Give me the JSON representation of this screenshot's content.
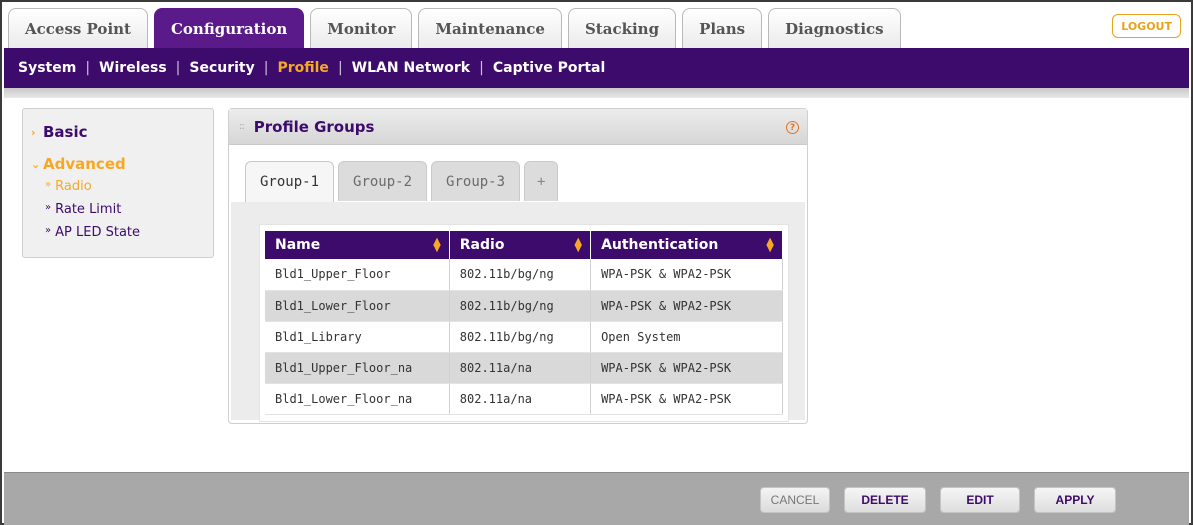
{
  "top_tabs": [
    {
      "label": "Access Point",
      "active": false
    },
    {
      "label": "Configuration",
      "active": true
    },
    {
      "label": "Monitor",
      "active": false
    },
    {
      "label": "Maintenance",
      "active": false
    },
    {
      "label": "Stacking",
      "active": false
    },
    {
      "label": "Plans",
      "active": false
    },
    {
      "label": "Diagnostics",
      "active": false
    }
  ],
  "logout_label": "LOGOUT",
  "subnav": [
    {
      "label": "System",
      "active": false
    },
    {
      "label": "Wireless",
      "active": false
    },
    {
      "label": "Security",
      "active": false
    },
    {
      "label": "Profile",
      "active": true
    },
    {
      "label": "WLAN Network",
      "active": false
    },
    {
      "label": "Captive Portal",
      "active": false
    }
  ],
  "left_menu": {
    "basic": "Basic",
    "advanced": "Advanced",
    "sub_items": [
      {
        "label": "Radio",
        "active": true
      },
      {
        "label": "Rate Limit",
        "active": false
      },
      {
        "label": "AP LED State",
        "active": false
      }
    ]
  },
  "panel": {
    "title": "Profile Groups",
    "help_icon_glyph": "?",
    "group_tabs": [
      "Group-1",
      "Group-2",
      "Group-3",
      "+"
    ],
    "active_group": 0,
    "table": {
      "columns": [
        "Name",
        "Radio",
        "Authentication"
      ],
      "rows": [
        [
          "Bld1_Upper_Floor",
          "802.11b/bg/ng",
          "WPA-PSK & WPA2-PSK"
        ],
        [
          "Bld1_Lower_Floor",
          "802.11b/bg/ng",
          "WPA-PSK & WPA2-PSK"
        ],
        [
          "Bld1_Library",
          "802.11b/bg/ng",
          "Open System"
        ],
        [
          "Bld1_Upper_Floor_na",
          "802.11a/na",
          "WPA-PSK & WPA2-PSK"
        ],
        [
          "Bld1_Lower_Floor_na",
          "802.11a/na",
          "WPA-PSK & WPA2-PSK"
        ]
      ]
    }
  },
  "footer": {
    "cancel": "CANCEL",
    "delete": "DELETE",
    "edit": "EDIT",
    "apply": "APPLY"
  },
  "colors": {
    "brand_purple": "#3d0b6b",
    "accent_orange": "#f7a823"
  }
}
